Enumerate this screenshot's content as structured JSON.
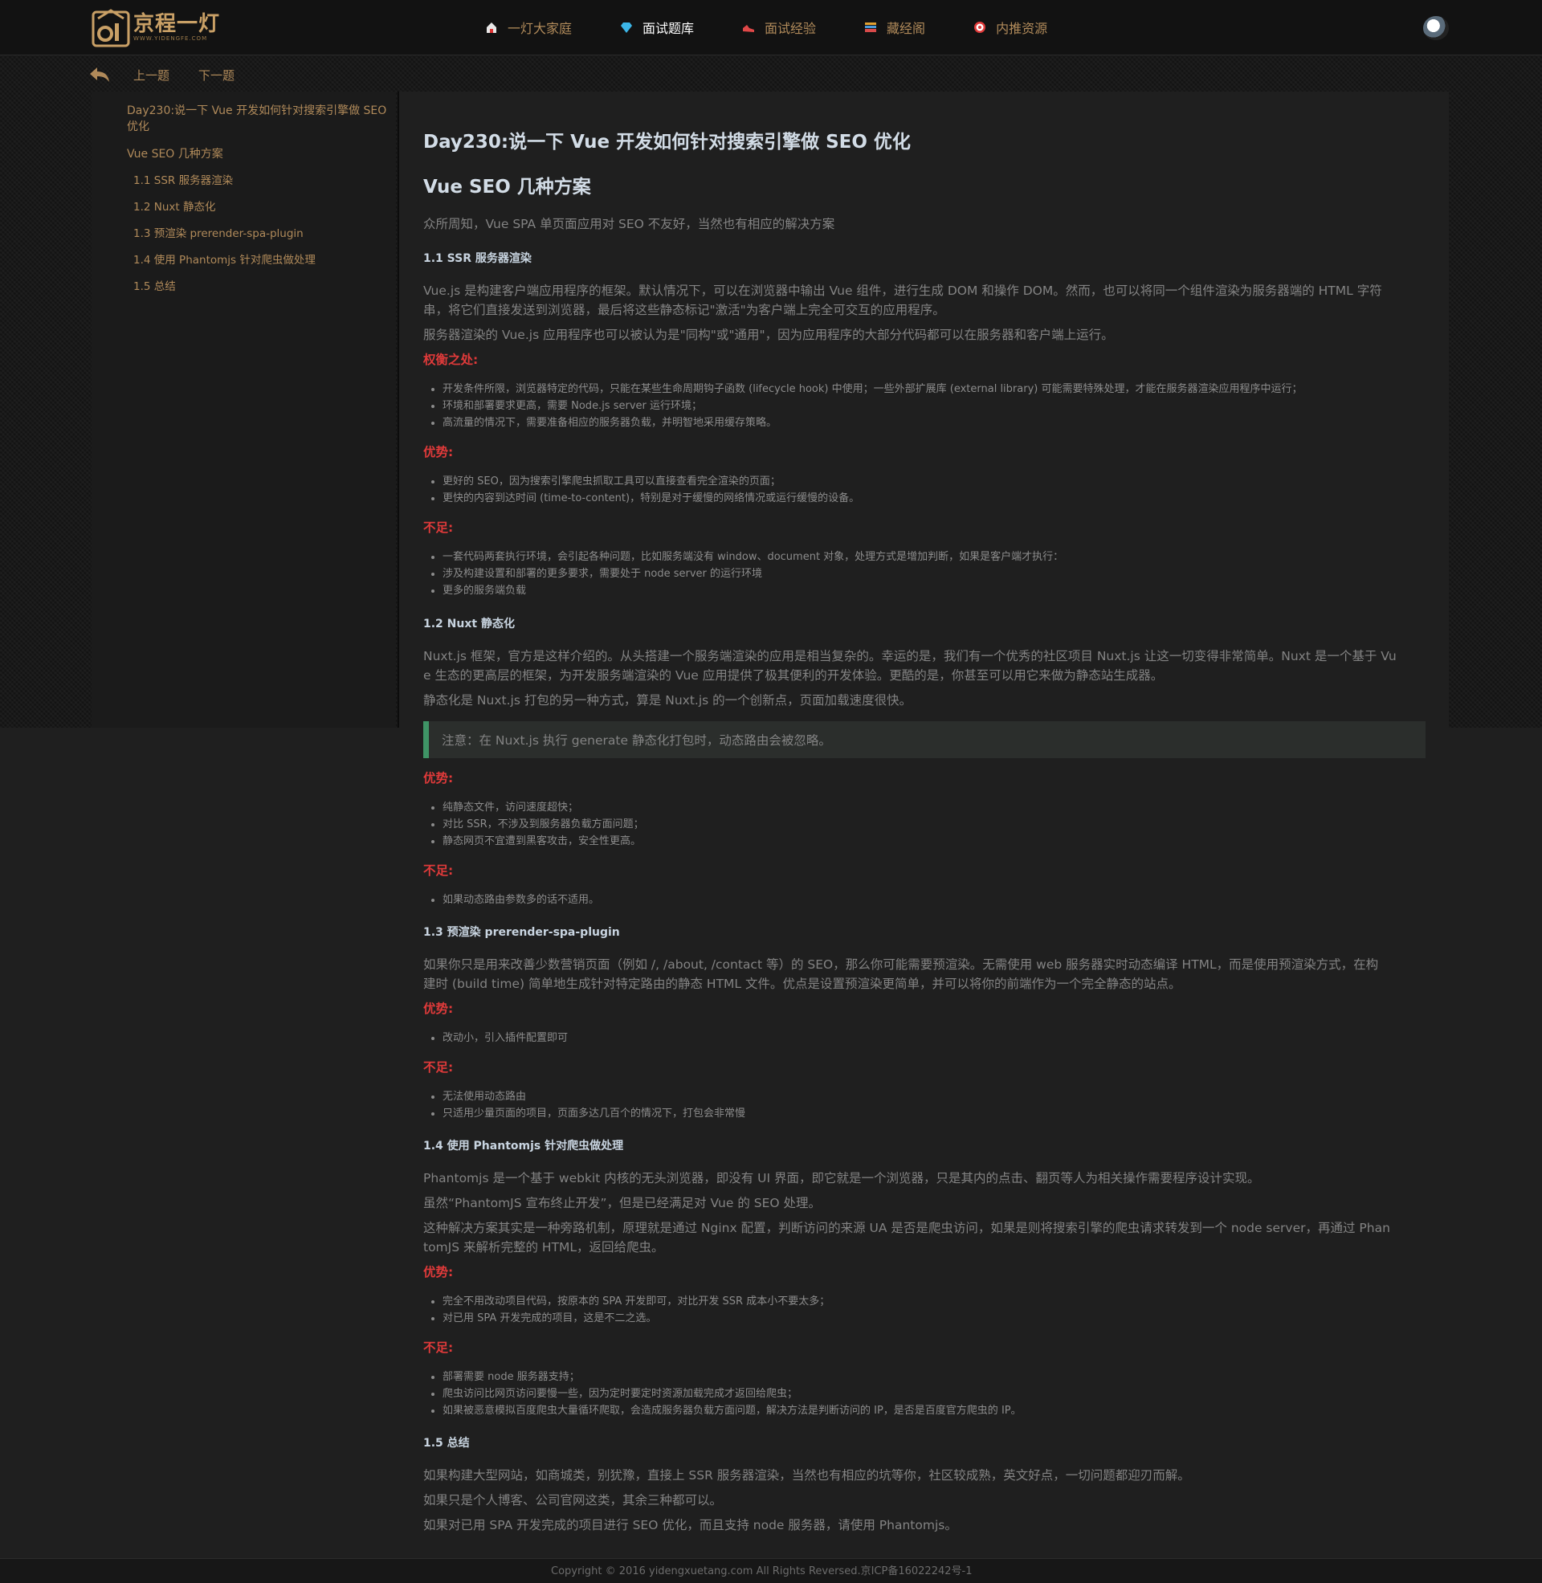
{
  "header": {
    "logo_text": "京程一灯",
    "logo_sub": "WWW.YIDENGFE.COM",
    "nav": [
      {
        "label": "一灯大家庭",
        "icon": "home-icon"
      },
      {
        "label": "面试题库",
        "icon": "diamond-icon"
      },
      {
        "label": "面试经验",
        "icon": "shoe-icon"
      },
      {
        "label": "藏经阁",
        "icon": "books-icon"
      },
      {
        "label": "内推资源",
        "icon": "target-icon"
      }
    ],
    "avatar": "avatar"
  },
  "subnav": {
    "prev": "上一题",
    "next": "下一题"
  },
  "toc": [
    "Day230:说一下 Vue 开发如何针对搜索引擎做 SEO 优化",
    "Vue SEO 几种方案",
    "1.1 SSR 服务器渲染",
    "1.2 Nuxt 静态化",
    "1.3 预渲染 prerender-spa-plugin",
    "1.4 使用 Phantomjs 针对爬虫做处理",
    "1.5 总结"
  ],
  "article": {
    "title": "Day230:说一下 Vue 开发如何针对搜索引擎做 SEO 优化",
    "h2": "Vue SEO 几种方案",
    "intro": "众所周知，Vue SPA 单页面应用对 SEO 不友好，当然也有相应的解决方案",
    "s1": {
      "heading": "1.1 SSR 服务器渲染",
      "p1a": "Vue.js 是构建客户端应用程序的框架。默认情况下，可以在浏览器中输出 Vue 组件，进行生成 DOM 和操作 DOM。然而，也可以将同一个组件渲染为服务器端的 HTML 字符",
      "p1b": "串，将它们直接发送到浏览器，最后将这些静态标记\"激活\"为客户端上完全可交互的应用程序。",
      "p2": "服务器渲染的 Vue.js 应用程序也可以被认为是\"同构\"或\"通用\"，因为应用程序的大部分代码都可以在服务器和客户端上运行。",
      "tradeoff_label": "权衡之处:",
      "tradeoffs": [
        "开发条件所限，浏览器特定的代码，只能在某些生命周期钩子函数 (lifecycle hook) 中使用；一些外部扩展库 (external library) 可能需要特殊处理，才能在服务器渲染应用程序中运行；",
        "环境和部署要求更高，需要 Node.js server 运行环境；",
        "高流量的情况下，需要准备相应的服务器负载，并明智地采用缓存策略。"
      ],
      "pros_label": "优势:",
      "pros": [
        "更好的 SEO，因为搜索引擎爬虫抓取工具可以直接查看完全渲染的页面；",
        "更快的内容到达时间 (time-to-content)，特别是对于缓慢的网络情况或运行缓慢的设备。"
      ],
      "cons_label": "不足:",
      "cons": [
        "一套代码两套执行环境，会引起各种问题，比如服务端没有 window、document 对象，处理方式是增加判断，如果是客户端才执行：",
        "涉及构建设置和部署的更多要求，需要处于 node server 的运行环境",
        "更多的服务端负载"
      ]
    },
    "s2": {
      "heading": "1.2 Nuxt 静态化",
      "p1a": "Nuxt.js 框架，官方是这样介绍的。从头搭建一个服务端渲染的应用是相当复杂的。幸运的是，我们有一个优秀的社区项目 Nuxt.js 让这一切变得非常简单。Nuxt 是一个基于 Vu",
      "p1b": "e 生态的更高层的框架，为开发服务端渲染的 Vue 应用提供了极其便利的开发体验。更酷的是，你甚至可以用它来做为静态站生成器。",
      "p2": "静态化是 Nuxt.js 打包的另一种方式，算是 Nuxt.js 的一个创新点，页面加载速度很快。",
      "note": "注意：在 Nuxt.js 执行 generate 静态化打包时，动态路由会被忽略。",
      "pros_label": "优势:",
      "pros": [
        "纯静态文件，访问速度超快；",
        "对比 SSR，不涉及到服务器负载方面问题；",
        "静态网页不宜遭到黑客攻击，安全性更高。"
      ],
      "cons_label": "不足:",
      "cons": [
        "如果动态路由参数多的话不适用。"
      ]
    },
    "s3": {
      "heading": "1.3 预渲染 prerender-spa-plugin",
      "p1a": "如果你只是用来改善少数营销页面（例如 /, /about, /contact 等）的 SEO，那么你可能需要预渲染。无需使用 web 服务器实时动态编译 HTML，而是使用预渲染方式，在构",
      "p1b": "建时 (build time) 简单地生成针对特定路由的静态 HTML 文件。优点是设置预渲染更简单，并可以将你的前端作为一个完全静态的站点。",
      "pros_label": "优势:",
      "pros": [
        "改动小，引入插件配置即可"
      ],
      "cons_label": "不足:",
      "cons": [
        "无法使用动态路由",
        "只适用少量页面的项目，页面多达几百个的情况下，打包会非常慢"
      ]
    },
    "s4": {
      "heading": "1.4 使用 Phantomjs 针对爬虫做处理",
      "p1": "Phantomjs 是一个基于 webkit 内核的无头浏览器，即没有 UI 界面，即它就是一个浏览器，只是其内的点击、翻页等人为相关操作需要程序设计实现。",
      "p2": "虽然“PhantomJS 宣布终止开发”，但是已经满足对 Vue 的 SEO 处理。",
      "p3a": "这种解决方案其实是一种旁路机制，原理就是通过 Nginx 配置，判断访问的来源 UA 是否是爬虫访问，如果是则将搜索引擎的爬虫请求转发到一个 node server，再通过 Phan",
      "p3b": "tomJS 来解析完整的 HTML，返回给爬虫。",
      "pros_label": "优势:",
      "pros": [
        "完全不用改动项目代码，按原本的 SPA 开发即可，对比开发 SSR 成本小不要太多；",
        "对已用 SPA 开发完成的项目，这是不二之选。"
      ],
      "cons_label": "不足:",
      "cons": [
        "部署需要 node 服务器支持；",
        "爬虫访问比网页访问要慢一些，因为定时要定时资源加载完成才返回给爬虫；",
        "如果被恶意模拟百度爬虫大量循环爬取，会造成服务器负载方面问题，解决方法是判断访问的 IP，是否是百度官方爬虫的 IP。"
      ]
    },
    "s5": {
      "heading": "1.5 总结",
      "p1": "如果构建大型网站，如商城类，别犹豫，直接上 SSR 服务器渲染，当然也有相应的坑等你，社区较成熟，英文好点，一切问题都迎刃而解。",
      "p2": "如果只是个人博客、公司官网这类，其余三种都可以。",
      "p3": "如果对已用 SPA 开发完成的项目进行 SEO 优化，而且支持 node 服务器，请使用 Phantomjs。"
    }
  },
  "footer": "Copyright © 2016 yidengxuetang.com All Rights Reversed.京ICP备16022242号-1"
}
